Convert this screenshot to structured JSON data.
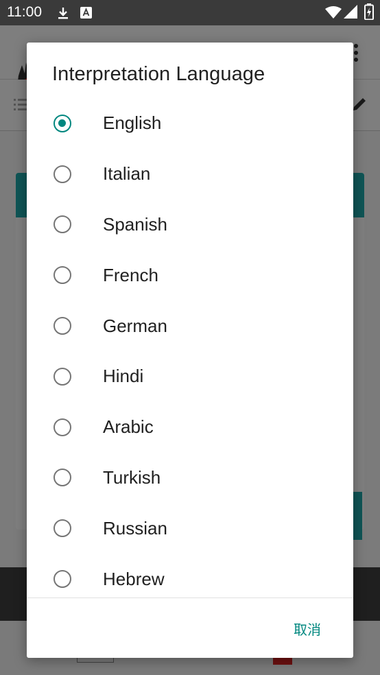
{
  "status_bar": {
    "time": "11:00",
    "icons": [
      "download-icon",
      "font-icon",
      "wifi-icon",
      "signal-icon",
      "battery-icon"
    ]
  },
  "dialog": {
    "title": "Interpretation Language",
    "options": [
      {
        "label": "English",
        "checked": true
      },
      {
        "label": "Italian",
        "checked": false
      },
      {
        "label": "Spanish",
        "checked": false
      },
      {
        "label": "French",
        "checked": false
      },
      {
        "label": "German",
        "checked": false
      },
      {
        "label": "Hindi",
        "checked": false
      },
      {
        "label": "Arabic",
        "checked": false
      },
      {
        "label": "Turkish",
        "checked": false
      },
      {
        "label": "Russian",
        "checked": false
      },
      {
        "label": "Hebrew",
        "checked": false
      }
    ],
    "cancel_label": "取消"
  },
  "colors": {
    "accent": "#00877f",
    "scrim_app_bar": "#0f5556"
  }
}
